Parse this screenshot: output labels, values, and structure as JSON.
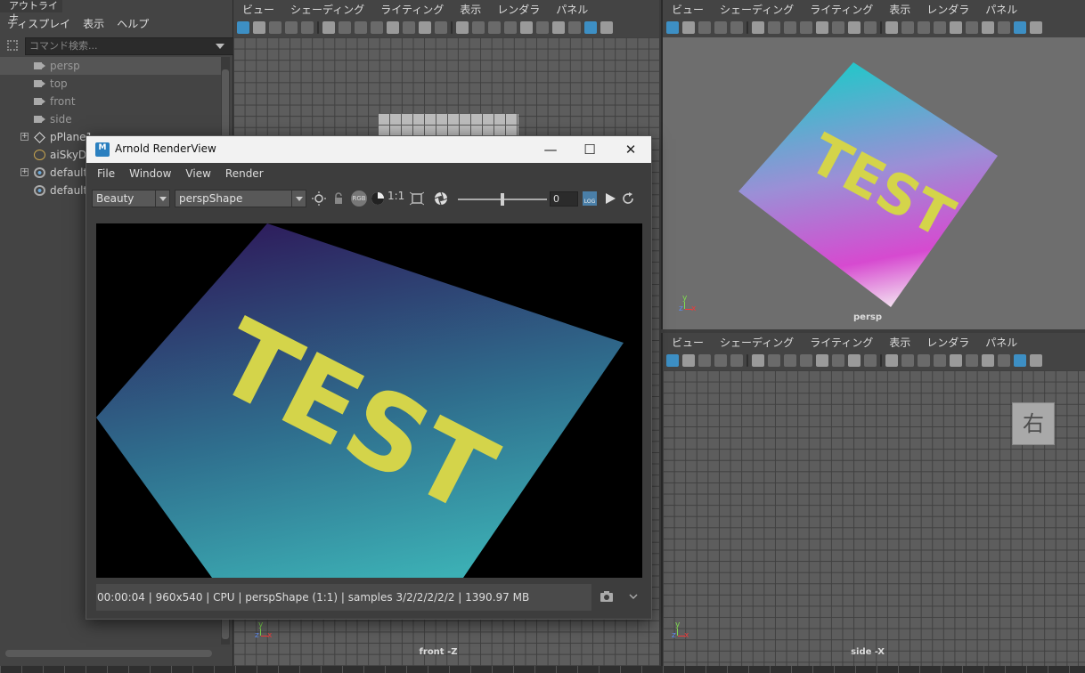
{
  "outliner": {
    "title": "アウトライナ",
    "menu": [
      "ディスプレイ",
      "表示",
      "ヘルプ"
    ],
    "search_placeholder": "コマンド検索...",
    "items": [
      {
        "label": "persp"
      },
      {
        "label": "top"
      },
      {
        "label": "front"
      },
      {
        "label": "side"
      },
      {
        "label": "pPlane1"
      },
      {
        "label": "aiSkyDo"
      },
      {
        "label": "default"
      },
      {
        "label": "default"
      }
    ]
  },
  "viewport_menu": [
    "ビュー",
    "シェーディング",
    "ライティング",
    "表示",
    "レンダラ",
    "パネル"
  ],
  "viewports": {
    "front": {
      "label": "front -Z"
    },
    "persp": {
      "label": "persp",
      "plane_text": "TEST"
    },
    "side": {
      "label": "side -X",
      "orient_button": "右"
    }
  },
  "axis": {
    "y": "y",
    "z": "z",
    "x": "x"
  },
  "arnold": {
    "logo": "M",
    "title": "Arnold RenderView",
    "minimize": "—",
    "maximize": "☐",
    "close": "✕",
    "menu": [
      "File",
      "Window",
      "View",
      "Render"
    ],
    "aov": "Beauty",
    "camera": "perspShape",
    "rgb": "RGB",
    "ratio": "1:1",
    "exposure": "0",
    "log": "LOG",
    "render_text": "TEST",
    "status": "00:00:04 | 960x540 | CPU | perspShape (1:1) | samples 3/2/2/2/2/2 | 1390.97 MB"
  },
  "colors": {
    "accent": "#3d8fc4",
    "test_text": "#d4d44a"
  }
}
